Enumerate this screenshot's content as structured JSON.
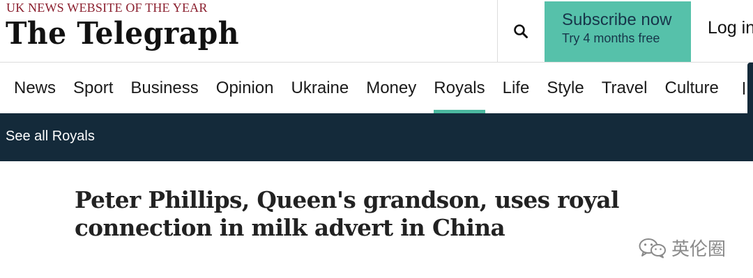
{
  "header": {
    "tagline": "UK NEWS WEBSITE OF THE YEAR",
    "logo": "The Telegraph",
    "search_icon": "search-icon",
    "subscribe": {
      "main": "Subscribe now",
      "sub": "Try 4 months free"
    },
    "login": "Log in"
  },
  "nav": {
    "items": [
      {
        "label": "News"
      },
      {
        "label": "Sport"
      },
      {
        "label": "Business"
      },
      {
        "label": "Opinion"
      },
      {
        "label": "Ukraine"
      },
      {
        "label": "Money"
      },
      {
        "label": "Royals",
        "active": true
      },
      {
        "label": "Life"
      },
      {
        "label": "Style"
      },
      {
        "label": "Travel"
      },
      {
        "label": "Culture"
      }
    ]
  },
  "section": {
    "link": "See all Royals"
  },
  "article": {
    "headline": "Peter Phillips, Queen's grandson, uses royal connection in milk advert in China"
  },
  "watermark": {
    "icon": "wechat-icon",
    "text": "英伦圈"
  },
  "colors": {
    "accent": "#56c1aa",
    "section_bar": "#142a3a",
    "tagline": "#8a1e2d"
  }
}
